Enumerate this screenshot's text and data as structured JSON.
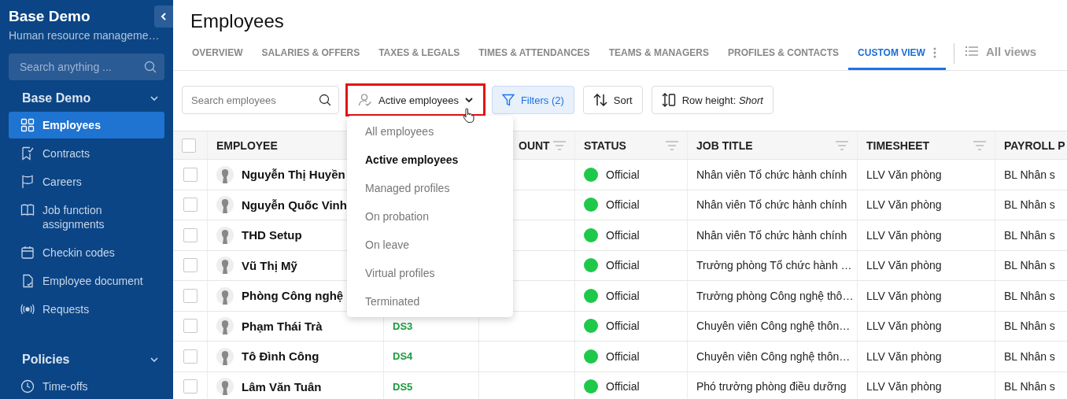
{
  "sidebar": {
    "title": "Base Demo",
    "subtitle": "Human resource manageme…",
    "search": {
      "placeholder": "Search anything ..."
    },
    "sections": [
      {
        "label": "Base Demo",
        "items": [
          {
            "label": "Employees",
            "selected": true
          },
          {
            "label": "Contracts",
            "selected": false
          },
          {
            "label": "Careers",
            "selected": false
          },
          {
            "label": "Job function assignments",
            "selected": false
          },
          {
            "label": "Checkin codes",
            "selected": false
          },
          {
            "label": "Employee document",
            "selected": false
          },
          {
            "label": "Requests",
            "selected": false
          }
        ]
      },
      {
        "label": "Policies",
        "items": [
          {
            "label": "Time-offs",
            "selected": false
          }
        ]
      }
    ]
  },
  "page": {
    "title": "Employees"
  },
  "tabs": [
    {
      "label": "OVERVIEW",
      "selected": false
    },
    {
      "label": "SALARIES & OFFERS",
      "selected": false
    },
    {
      "label": "TAXES & LEGALS",
      "selected": false
    },
    {
      "label": "TIMES & ATTENDANCES",
      "selected": false
    },
    {
      "label": "TEAMS & MANAGERS",
      "selected": false
    },
    {
      "label": "PROFILES & CONTACTS",
      "selected": false
    },
    {
      "label": "CUSTOM VIEW",
      "selected": true
    }
  ],
  "all_views": "All views",
  "toolbar": {
    "search": {
      "placeholder": "Search employees"
    },
    "view_select": "Active employees",
    "filters": "Filters (2)",
    "sort": "Sort",
    "row_height": "Row height: *Short*"
  },
  "dropdown": [
    {
      "label": "All employees",
      "selected": false
    },
    {
      "label": "Active employees",
      "selected": true
    },
    {
      "label": "Managed profiles",
      "selected": false
    },
    {
      "label": "On probation",
      "selected": false
    },
    {
      "label": "On leave",
      "selected": false
    },
    {
      "label": "Virtual profiles",
      "selected": false
    },
    {
      "label": "Terminated",
      "selected": false
    }
  ],
  "table": {
    "select_all": {
      "checked": false
    },
    "columns": [
      "EMPLOYEE",
      "",
      "OUNT",
      "STATUS",
      "JOB TITLE",
      "TIMESHEET",
      "PAYROLL P"
    ],
    "rows": [
      {
        "name": "Nguyễn Thị Huyền",
        "checked": false,
        "status": "Official",
        "color": "#1ec94a",
        "job": "Nhân viên Tổ chức hành chính",
        "timesheet": "LLV Văn phòng",
        "payroll": "BL Nhân s"
      },
      {
        "name": "Nguyễn Quốc Vinh",
        "checked": false,
        "status": "Official",
        "color": "#1ec94a",
        "job": "Nhân viên Tổ chức hành chính",
        "timesheet": "LLV Văn phòng",
        "payroll": "BL Nhân s"
      },
      {
        "name": "THD Setup",
        "checked": false,
        "status": "Official",
        "color": "#1ec94a",
        "job": "Nhân viên Tổ chức hành chính",
        "timesheet": "LLV Văn phòng",
        "payroll": "BL Nhân s"
      },
      {
        "name": "Vũ Thị Mỹ",
        "checked": false,
        "status": "Official",
        "color": "#1ec94a",
        "job": "Trưởng phòng Tổ chức hành …",
        "timesheet": "LLV Văn phòng",
        "payroll": "BL Nhân s"
      },
      {
        "name": "Phòng Công nghệ",
        "checked": false,
        "status": "Official",
        "color": "#1ec94a",
        "job": "Trưởng phòng Công nghệ thô…",
        "timesheet": "LLV Văn phòng",
        "payroll": "BL Nhân s"
      },
      {
        "name": "Phạm Thái Trà",
        "checked": false,
        "code": "DS3",
        "status": "Official",
        "color": "#1ec94a",
        "job": "Chuyên viên Công nghệ thôn…",
        "timesheet": "LLV Văn phòng",
        "payroll": "BL Nhân s"
      },
      {
        "name": "Tô Đình Công",
        "checked": false,
        "code": "DS4",
        "status": "Official",
        "color": "#1ec94a",
        "job": "Chuyên viên Công nghệ thôn…",
        "timesheet": "LLV Văn phòng",
        "payroll": "BL Nhân s"
      },
      {
        "name": "Lâm Văn Tuân",
        "checked": false,
        "code": "DS5",
        "status": "Official",
        "color": "#1ec94a",
        "job": "Phó trưởng phòng điều dưỡng",
        "timesheet": "LLV Văn phòng",
        "payroll": "BL Nhân s"
      }
    ]
  }
}
